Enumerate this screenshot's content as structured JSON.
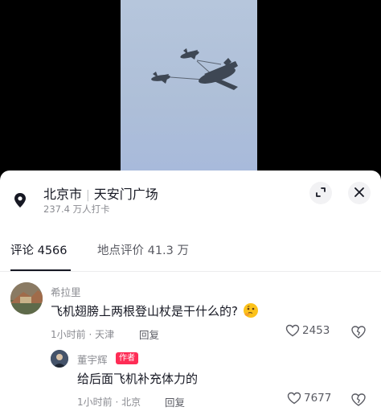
{
  "location": {
    "city": "北京市",
    "place": "天安门广场",
    "checkins": "237.4 万人打卡"
  },
  "tabs": [
    {
      "label": "评论 4566"
    },
    {
      "label": "地点评价 41.3 万"
    }
  ],
  "comments": [
    {
      "user": "希拉里",
      "text": "飞机翅膀上两根登山杖是干什么的?",
      "time_place": "1小时前 · 天津",
      "reply_label": "回复",
      "likes": "2453"
    },
    {
      "user": "董宇辉",
      "tag": "作者",
      "text": "给后面飞机补充体力的",
      "time_place": "1小时前 · 北京",
      "reply_label": "回复",
      "likes": "7677"
    }
  ]
}
